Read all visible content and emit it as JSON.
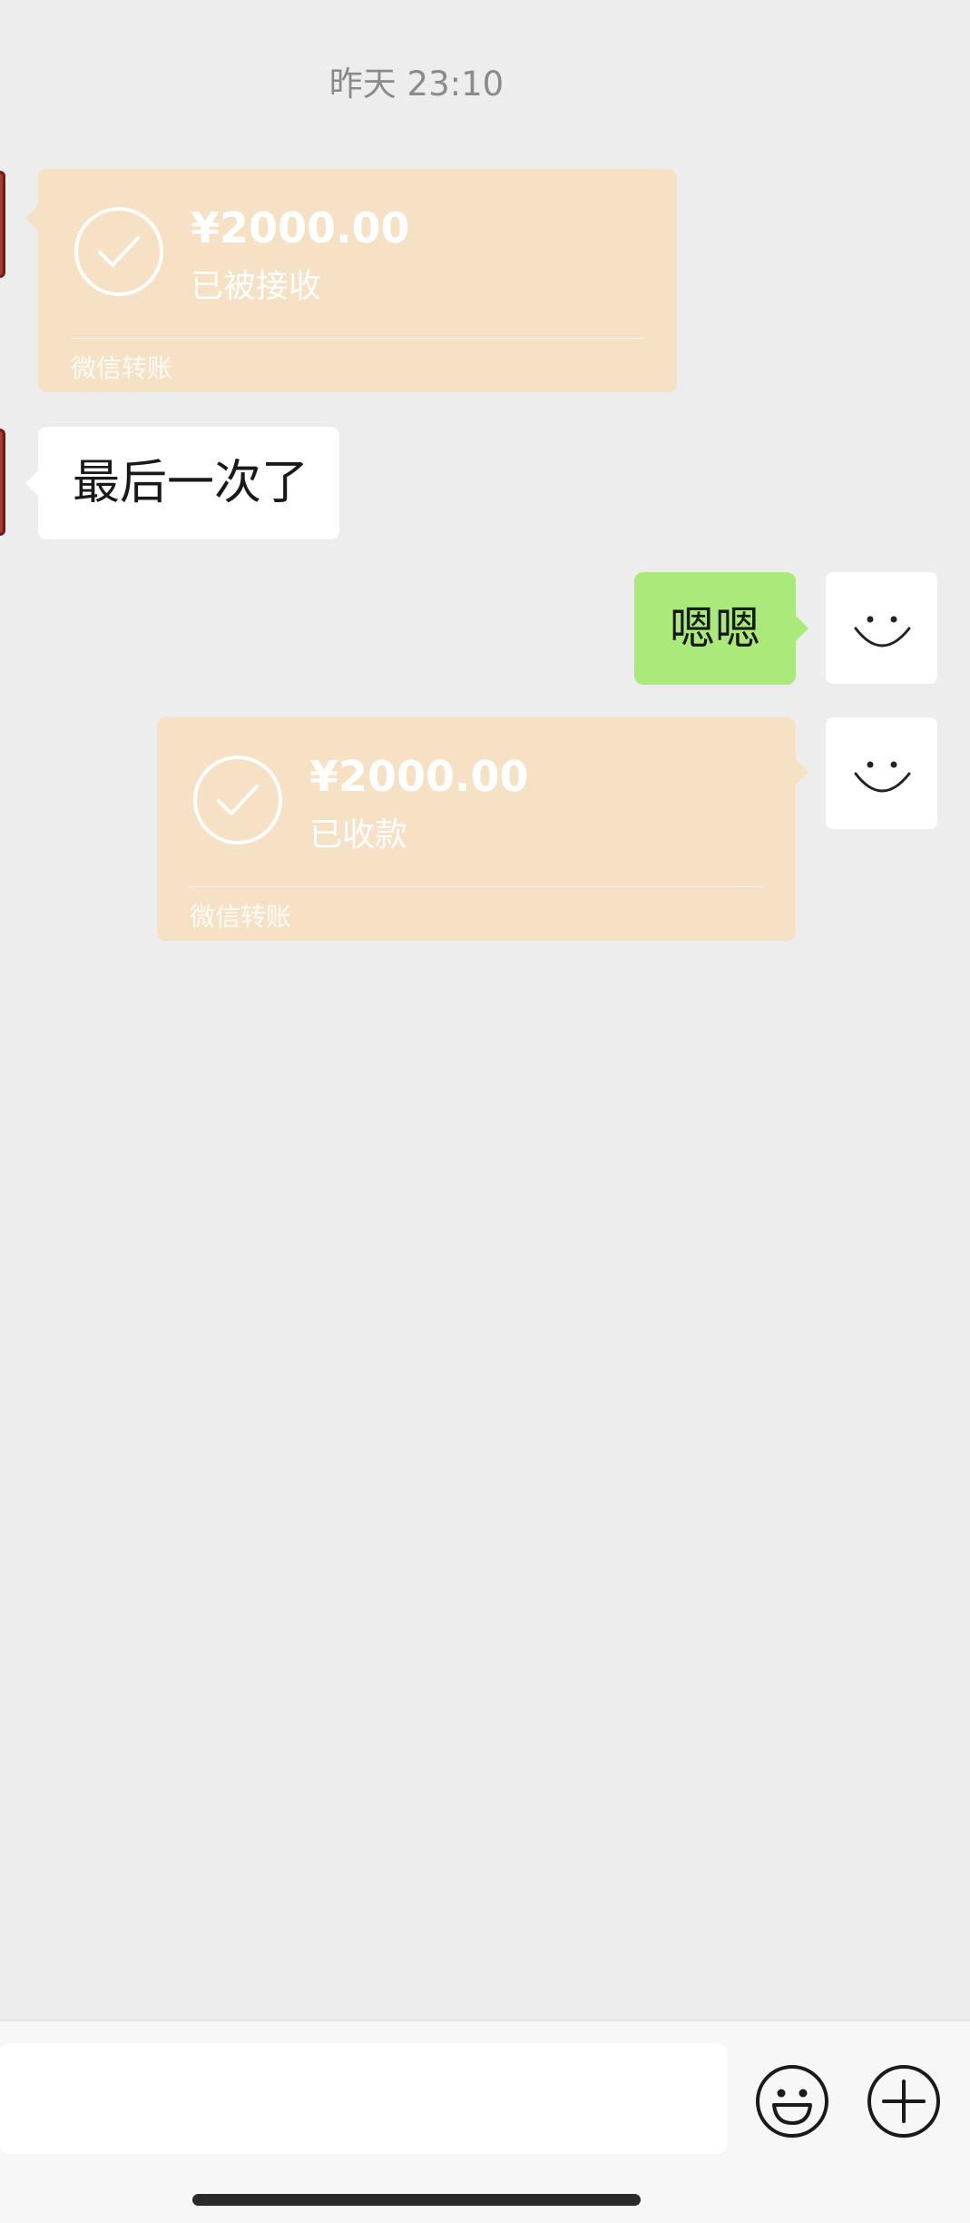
{
  "chat": {
    "timestamp": "昨天 23:10",
    "messages": [
      {
        "type": "transfer",
        "side": "left",
        "amount": "¥2000.00",
        "status": "已被接收",
        "footer": "微信转账"
      },
      {
        "type": "text",
        "side": "left",
        "text": "最后一次了"
      },
      {
        "type": "text",
        "side": "right",
        "text": "嗯嗯"
      },
      {
        "type": "transfer",
        "side": "right",
        "amount": "¥2000.00",
        "status": "已收款",
        "footer": "微信转账"
      }
    ]
  },
  "input_bar": {
    "message_value": "",
    "emoji_icon": "emoji-icon",
    "plus_icon": "plus-icon"
  },
  "colors": {
    "background": "#ededed",
    "transfer_card": "#f6e1c5",
    "sent_bubble": "#a9ea7a",
    "received_bubble": "#ffffff",
    "avatar_left": "#a33b34"
  }
}
